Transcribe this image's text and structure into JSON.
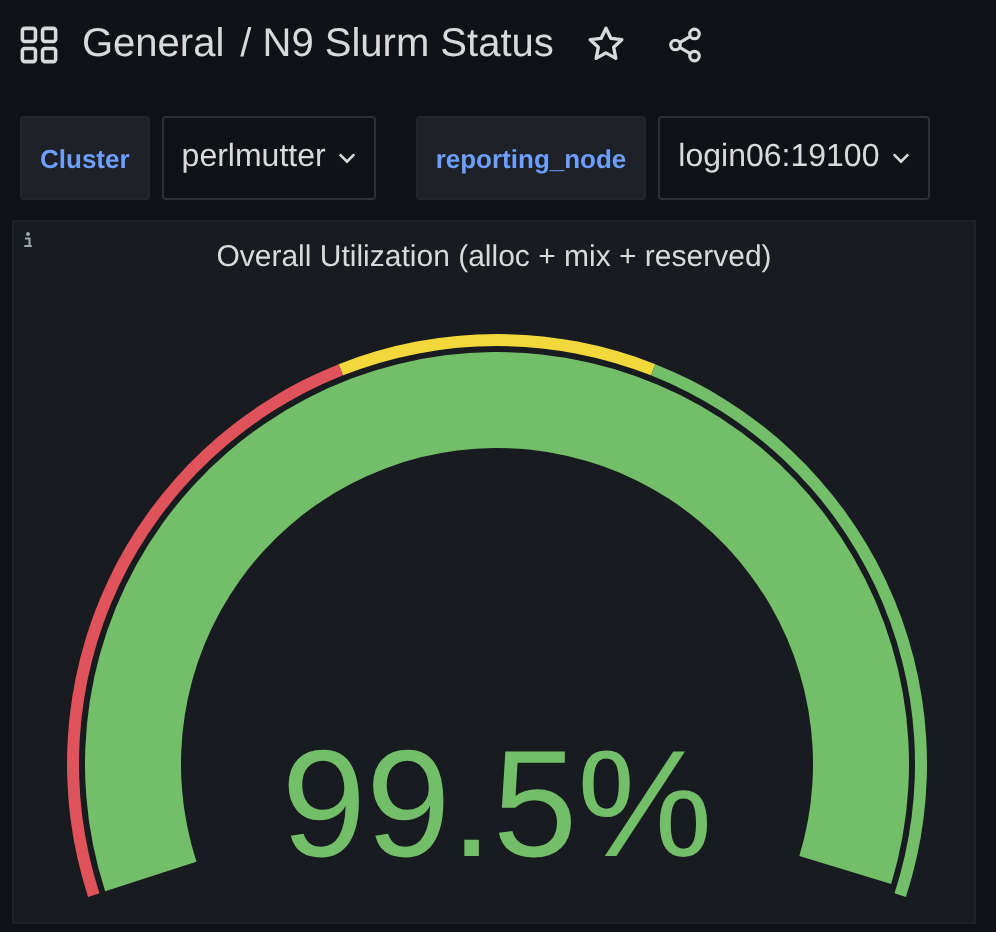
{
  "header": {
    "folder": "General",
    "title": "/ N9 Slurm Status"
  },
  "variables": [
    {
      "label": "Cluster",
      "value": "perlmutter"
    },
    {
      "label": "reporting_node",
      "value": "login06:19100"
    }
  ],
  "panel": {
    "title": "Overall Utilization (alloc + mix + reserved)",
    "gauge": {
      "value": "99.5%",
      "color": "#73bf69",
      "thresholds": [
        {
          "color": "#e0535b"
        },
        {
          "color": "#f2d83b"
        },
        {
          "color": "#73bf69"
        }
      ]
    }
  }
}
